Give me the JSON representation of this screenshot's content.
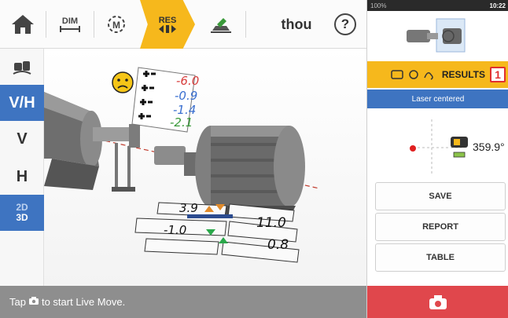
{
  "toolbar": {
    "dim_label": "DIM",
    "res_label": "RES",
    "unit_label": "thou",
    "help_label": "?"
  },
  "leftbar": {
    "vh_label": "V/H",
    "v_label": "V",
    "h_label": "H",
    "view_2d_label": "2D",
    "view_3d_label": "3D"
  },
  "tolerance_table": {
    "values": [
      "-6.0",
      "-0.9",
      "-1.4",
      "-2.1"
    ],
    "colors": [
      "#d8403f",
      "#3a6fd0",
      "#3a6fd0",
      "#3a9a3a"
    ]
  },
  "results": {
    "vertical_angularity": "3.9",
    "vertical_offset": "11.0",
    "horizontal_angularity": "-1.0",
    "horizontal_offset": "0.8"
  },
  "statusbar": {
    "hint_prefix": "Tap",
    "hint_suffix": "to start Live Move."
  },
  "rpanel": {
    "sys_left": "100%",
    "sys_time": "10:22",
    "results_label": "RESULTS",
    "results_badge": "1",
    "laser_status": "Laser centered",
    "angle": "359.9°",
    "buttons": [
      "SAVE",
      "REPORT",
      "TABLE"
    ]
  },
  "colors": {
    "accent_yellow": "#f6b81c",
    "accent_blue": "#3e74c1",
    "live_red": "#e0474c"
  },
  "icons": [
    "home-icon",
    "dim-icon",
    "measure-icon",
    "res-icon",
    "flip-icon",
    "help-icon",
    "camera-icon",
    "sad-face-icon"
  ]
}
